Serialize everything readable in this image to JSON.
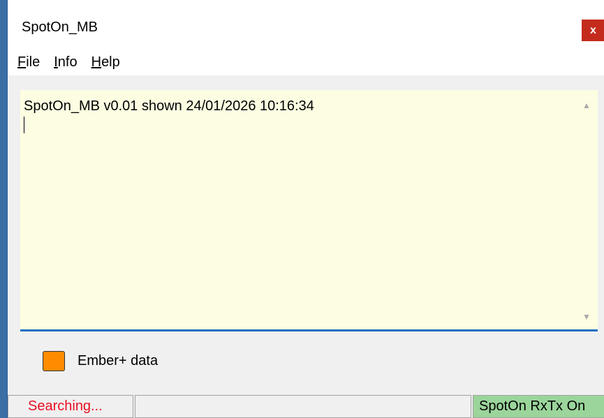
{
  "window": {
    "title": "SpotOn_MB",
    "close_label": "x"
  },
  "menu": {
    "items": [
      {
        "mnemonic": "F",
        "rest": "ile"
      },
      {
        "mnemonic": "I",
        "rest": "nfo"
      },
      {
        "mnemonic": "H",
        "rest": "elp"
      }
    ]
  },
  "log": {
    "text": "SpotOn_MB v0.01 shown 24/01/2026 10:16:34"
  },
  "scrollbar": {
    "up_icon": "▲",
    "down_icon": "▼"
  },
  "ember": {
    "label": "Ember+ data",
    "indicator_color": "#ff8c00"
  },
  "status": {
    "searching": "Searching...",
    "middle": "",
    "rxtx": "SpotOn RxTx On"
  }
}
